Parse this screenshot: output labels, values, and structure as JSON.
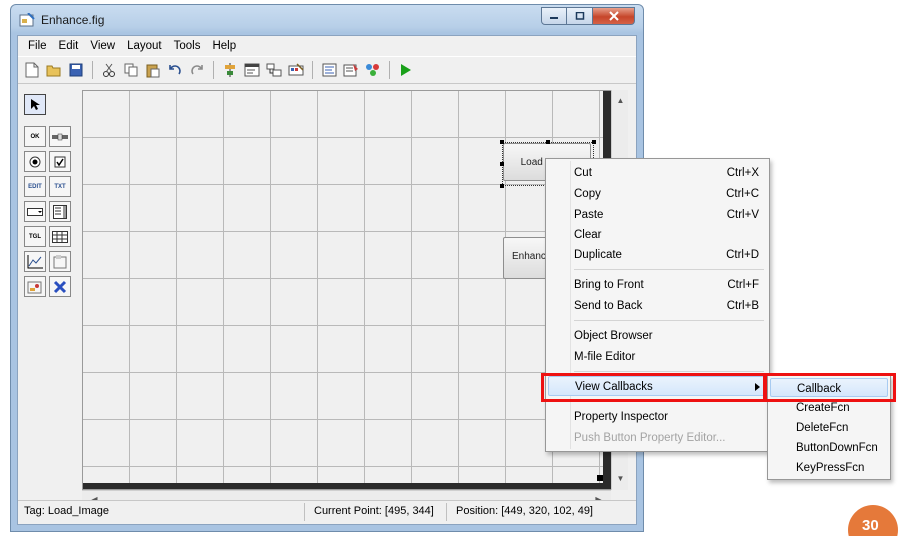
{
  "window": {
    "title": "Enhance.fig"
  },
  "menubar": [
    "File",
    "Edit",
    "View",
    "Layout",
    "Tools",
    "Help"
  ],
  "toolbar": {
    "icons": [
      "new-file-icon",
      "open-folder-icon",
      "save-icon",
      "cut-icon",
      "copy-icon",
      "paste-icon",
      "undo-icon",
      "redo-icon",
      "align-objects-icon",
      "menu-editor-icon",
      "tab-order-icon",
      "toolbar-editor-icon",
      "m-file-editor-icon",
      "property-inspector-icon",
      "object-browser-icon",
      "run-figure-icon"
    ]
  },
  "palette": {
    "items": [
      {
        "name": "select-tool-icon",
        "label": ""
      },
      {
        "name": "push-button-tool-icon",
        "label": "OK"
      },
      {
        "name": "slider-tool-icon",
        "label": ""
      },
      {
        "name": "radio-button-tool-icon",
        "label": ""
      },
      {
        "name": "checkbox-tool-icon",
        "label": ""
      },
      {
        "name": "edit-text-tool-icon",
        "label": "EDIT"
      },
      {
        "name": "static-text-tool-icon",
        "label": "TXT"
      },
      {
        "name": "popup-menu-tool-icon",
        "label": ""
      },
      {
        "name": "listbox-tool-icon",
        "label": ""
      },
      {
        "name": "toggle-button-tool-icon",
        "label": "TGL"
      },
      {
        "name": "table-tool-icon",
        "label": ""
      },
      {
        "name": "axes-tool-icon",
        "label": ""
      },
      {
        "name": "panel-tool-icon",
        "label": ""
      },
      {
        "name": "button-group-tool-icon",
        "label": ""
      },
      {
        "name": "activex-control-tool-icon",
        "label": ""
      }
    ]
  },
  "canvas": {
    "buttons": {
      "load": "Load Image",
      "enhance": "Enhance"
    }
  },
  "statusbar": {
    "tag": "Tag: Load_Image",
    "current_point": "Current Point:  [495, 344]",
    "position": "Position: [449, 320, 102, 49]"
  },
  "context_menu": {
    "cut": {
      "label": "Cut",
      "shortcut": "Ctrl+X"
    },
    "copy": {
      "label": "Copy",
      "shortcut": "Ctrl+C"
    },
    "paste": {
      "label": "Paste",
      "shortcut": "Ctrl+V"
    },
    "clear": {
      "label": "Clear"
    },
    "duplicate": {
      "label": "Duplicate",
      "shortcut": "Ctrl+D"
    },
    "bring_to_front": {
      "label": "Bring to Front",
      "shortcut": "Ctrl+F"
    },
    "send_to_back": {
      "label": "Send to Back",
      "shortcut": "Ctrl+B"
    },
    "object_browser": {
      "label": "Object Browser"
    },
    "mfile_editor": {
      "label": "M-file Editor"
    },
    "view_callbacks": {
      "label": "View Callbacks"
    },
    "property_inspector": {
      "label": "Property Inspector"
    },
    "push_button_editor": {
      "label": "Push Button Property Editor..."
    }
  },
  "submenu": [
    "Callback",
    "CreateFcn",
    "DeleteFcn",
    "ButtonDownFcn",
    "KeyPressFcn"
  ],
  "page_number": "30",
  "colors": {
    "highlight_box": "#ee1111",
    "badge": "#e5793a"
  }
}
